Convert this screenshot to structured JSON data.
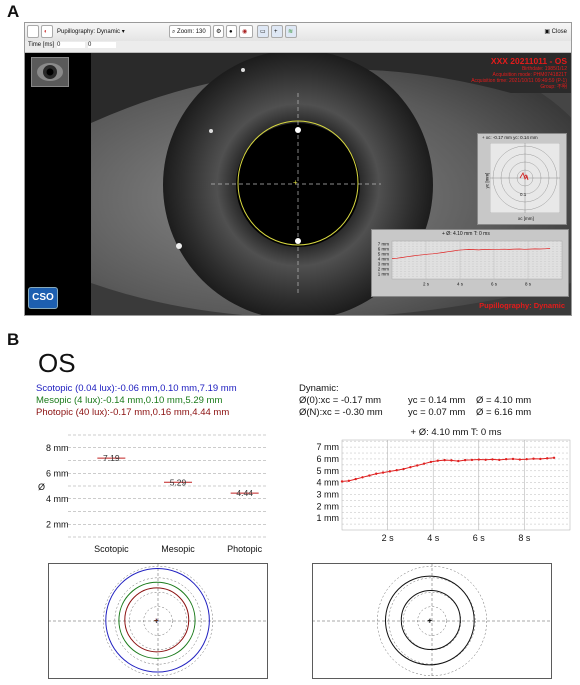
{
  "panels": {
    "a": "A",
    "b": "B"
  },
  "app": {
    "toolbar": {
      "mode_label": "Pupillography: Dynamic",
      "zoom_label": "Zoom: 130 %",
      "close_label": "Close"
    },
    "timebar": {
      "time_label": "Time [ms]",
      "value_1": "0",
      "value_2": "0"
    },
    "overlay": {
      "patient_line": "XXX 20211011 - OS",
      "info_1": "Birthdate: 1985/1/12",
      "info_2": "Acquisition mode: PHM0741821T",
      "info_3": "Acquisition time: 2021/10/11 09:49:59 (P-1)",
      "info_4": "Group: 不明",
      "brand": "CSO",
      "status": "Pupillography: Dynamic"
    },
    "track_mini": {
      "header": "+ xc: -0.17 mm   yc: 0.14 mm",
      "value": "0.1",
      "xlabel": "xc [mm]",
      "ylabel": "yc [mm]"
    },
    "diam_mini": {
      "header": "+ Ø: 4.10 mm    T: 0 ms",
      "ticks_y": [
        "7 mm",
        "6 mm",
        "5 mm",
        "4 mm",
        "3 mm",
        "2 mm",
        "1 mm"
      ],
      "ticks_x": [
        "2 s",
        "4 s",
        "6 s",
        "8 s"
      ]
    }
  },
  "section_b": {
    "eye_label": "OS",
    "legend": [
      {
        "text": "Scotopic (0.04 lux):-0.06 mm,0.10 mm,7.19 mm",
        "color": "#2020c0"
      },
      {
        "text": "Mesopic (4 lux):-0.14 mm,0.10 mm,5.29 mm",
        "color": "#1a7a1a"
      },
      {
        "text": "Photopic (40 lux):-0.17 mm,0.16 mm,4.44 mm",
        "color": "#8b1010"
      }
    ],
    "dynamic": {
      "title": "Dynamic:",
      "row1": {
        "a": "Ø(0):xc = -0.17 mm",
        "b": "yc = 0.14 mm",
        "c": "Ø = 4.10 mm"
      },
      "row2": {
        "a": "Ø(N):xc = -0.30 mm",
        "b": "yc = 0.07 mm",
        "c": "Ø = 6.16 mm"
      }
    }
  },
  "chart_data": [
    {
      "type": "scatter",
      "ylabel": "Ø",
      "categories": [
        "Scotopic",
        "Mesopic",
        "Photopic"
      ],
      "values": [
        7.19,
        5.29,
        4.44
      ],
      "value_labels": [
        "7.19",
        "5.29",
        "4.44"
      ],
      "y_ticks": [
        "2 mm",
        "4 mm",
        "6 mm",
        "8 mm"
      ],
      "ylim": [
        1,
        9
      ],
      "grid": true
    },
    {
      "type": "line",
      "header": "+ Ø: 4.10 mm    T: 0 ms",
      "x_unit": "s",
      "x": [
        0.0,
        0.3,
        0.6,
        0.9,
        1.2,
        1.5,
        1.8,
        2.1,
        2.4,
        2.7,
        3.0,
        3.3,
        3.6,
        3.9,
        4.2,
        4.5,
        4.8,
        5.1,
        5.4,
        5.7,
        6.0,
        6.3,
        6.6,
        6.9,
        7.2,
        7.5,
        7.8,
        8.1,
        8.4,
        8.7,
        9.0,
        9.3
      ],
      "y": [
        4.1,
        4.15,
        4.3,
        4.45,
        4.6,
        4.75,
        4.85,
        4.95,
        5.05,
        5.15,
        5.3,
        5.45,
        5.6,
        5.75,
        5.85,
        5.9,
        5.88,
        5.82,
        5.9,
        5.92,
        5.95,
        5.93,
        5.96,
        5.92,
        5.98,
        6.0,
        5.95,
        5.98,
        6.02,
        6.0,
        6.05,
        6.1
      ],
      "y_ticks": [
        "1 mm",
        "2 mm",
        "3 mm",
        "4 mm",
        "5 mm",
        "6 mm",
        "7 mm"
      ],
      "x_ticks": [
        "2 s",
        "4 s",
        "6 s",
        "8 s"
      ],
      "xlim": [
        0,
        10
      ],
      "ylim": [
        0,
        7.6
      ],
      "color": "#e02020",
      "grid": true
    },
    {
      "type": "scatter",
      "colors": [
        "#2020c0",
        "#1a7a1a",
        "#8b1010"
      ],
      "circles": [
        {
          "name": "Scotopic",
          "xc": -0.06,
          "yc": 0.1,
          "d": 7.19
        },
        {
          "name": "Mesopic",
          "xc": -0.14,
          "yc": 0.1,
          "d": 5.29
        },
        {
          "name": "Photopic",
          "xc": -0.17,
          "yc": 0.16,
          "d": 4.44
        }
      ]
    },
    {
      "type": "scatter",
      "circles": [
        {
          "xc": -0.17,
          "yc": 0.14,
          "d": 4.1
        },
        {
          "xc": -0.3,
          "yc": 0.07,
          "d": 6.16
        }
      ]
    }
  ]
}
